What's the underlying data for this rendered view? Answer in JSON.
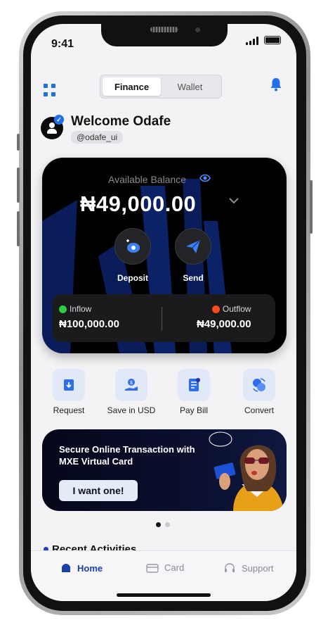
{
  "status_bar": {
    "time": "9:41"
  },
  "header": {
    "tabs": [
      {
        "label": "Finance",
        "active": true
      },
      {
        "label": "Wallet",
        "active": false
      }
    ]
  },
  "user": {
    "welcome": "Welcome Odafe",
    "handle": "@odafe_ui"
  },
  "balance_card": {
    "label": "Available Balance",
    "amount": "₦49,000.00",
    "actions": [
      {
        "label": "Deposit",
        "icon": "deposit-icon"
      },
      {
        "label": "Send",
        "icon": "send-icon"
      }
    ],
    "inflow": {
      "label": "Inflow",
      "amount": "₦100,000.00",
      "color": "#2ecc40"
    },
    "outflow": {
      "label": "Outflow",
      "amount": "₦49,000.00",
      "color": "#ff4a1a"
    }
  },
  "quick_actions": [
    {
      "label": "Request",
      "icon": "request-icon"
    },
    {
      "label": "Save in USD",
      "icon": "save-usd-icon"
    },
    {
      "label": "Pay Bill",
      "icon": "pay-bill-icon"
    },
    {
      "label": "Convert",
      "icon": "convert-icon"
    }
  ],
  "banner": {
    "title": "Secure Online Transaction with MXE Virtual Card",
    "cta": "I want one!"
  },
  "pager": {
    "count": 2,
    "active_index": 0
  },
  "recent": {
    "title": "Recent Activities"
  },
  "nav": [
    {
      "label": "Home",
      "icon": "home-icon",
      "active": true
    },
    {
      "label": "Card",
      "icon": "card-icon",
      "active": false
    },
    {
      "label": "Support",
      "icon": "headset-icon",
      "active": false
    }
  ],
  "colors": {
    "accent": "#1f6feb",
    "nav_active": "#1c3fa8",
    "card_bg": "#000000",
    "card_pattern": "#0a1d5a"
  }
}
